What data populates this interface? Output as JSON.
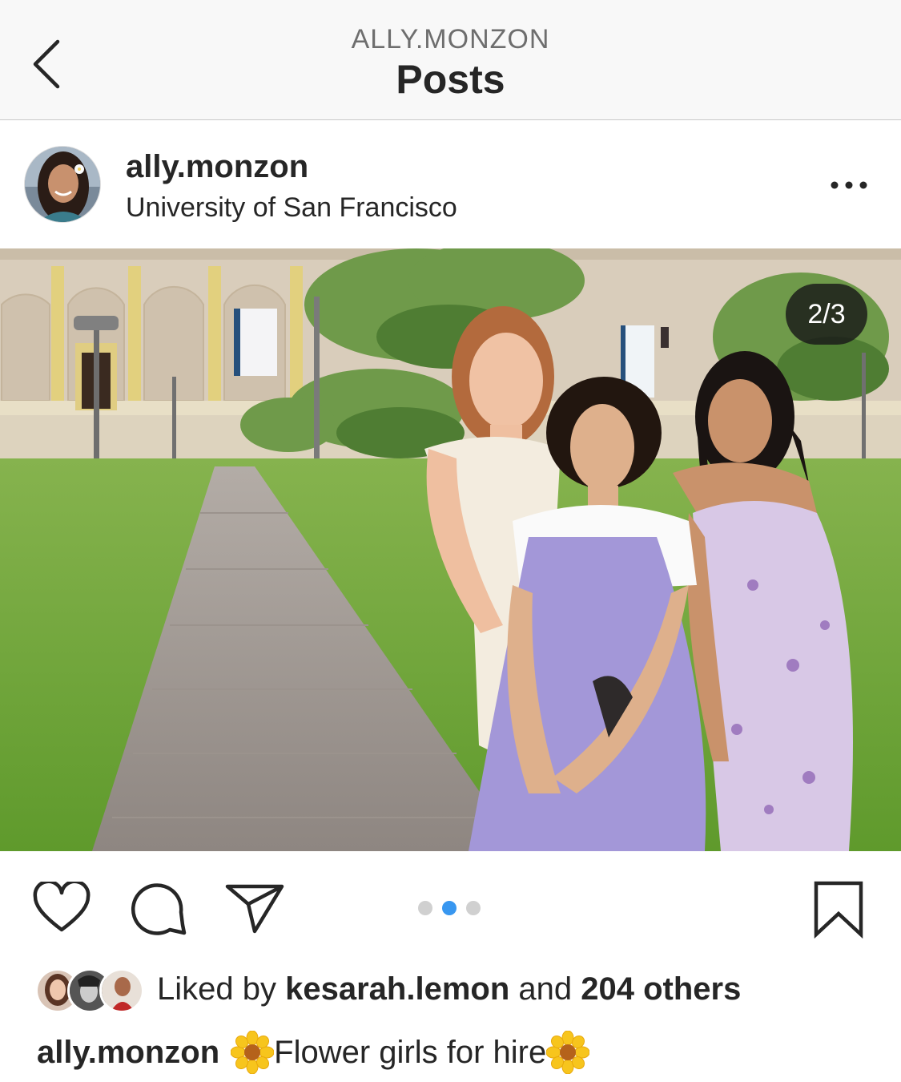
{
  "header": {
    "subtitle": "ALLY.MONZON",
    "title": "Posts"
  },
  "post": {
    "username": "ally.monzon",
    "location": "University of San Francisco",
    "carousel": {
      "counter": "2/3",
      "current_index": 2,
      "total": 3
    }
  },
  "likes": {
    "prefix": "Liked by",
    "first_liker": "kesarah.lemon",
    "conjunction": "and",
    "others": "204 others"
  },
  "caption": {
    "username": "ally.monzon",
    "text": "Flower girls for hire"
  },
  "colors": {
    "accent_dot": "#3897f0",
    "text": "#262626",
    "header_bg": "#f8f8f8"
  },
  "icons": [
    "chevron-left-icon",
    "more-icon",
    "heart-icon",
    "comment-icon",
    "share-icon",
    "bookmark-icon",
    "sunflower-emoji"
  ]
}
